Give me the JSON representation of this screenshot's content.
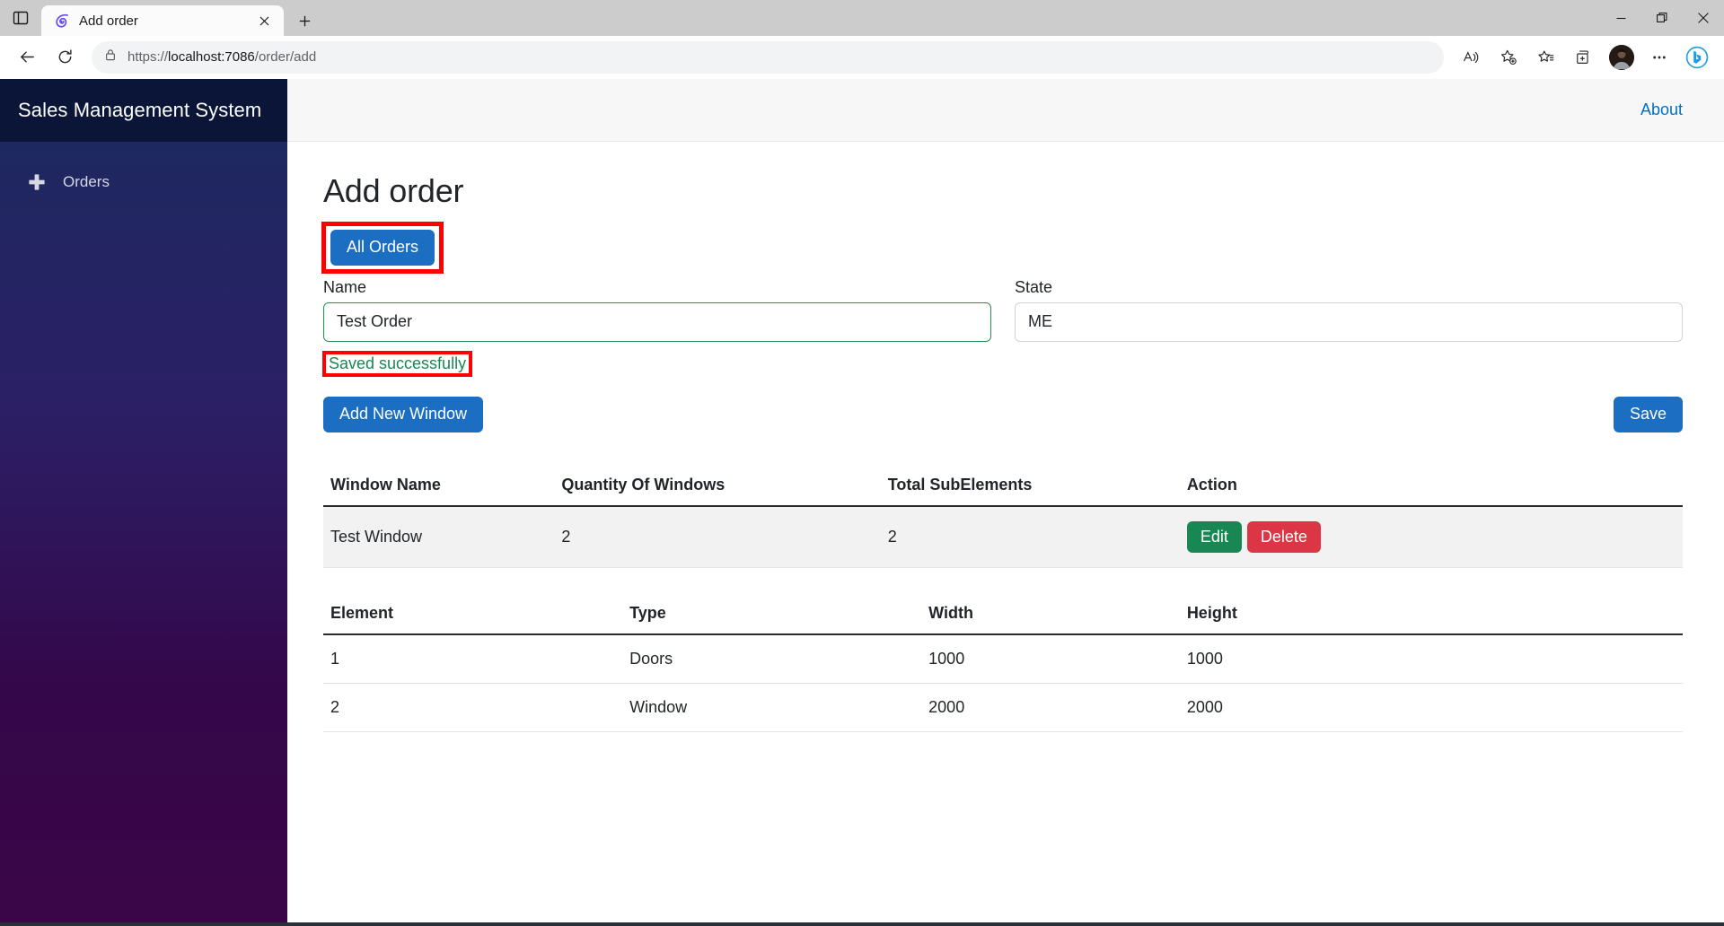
{
  "browser": {
    "tab": {
      "title": "Add order",
      "favicon_name": "blazor-favicon",
      "close_label": "×"
    },
    "new_tab_label": "+",
    "tab_list_icon": "tab-list-icon",
    "window_controls": {
      "minimize": "—",
      "restore": "restore",
      "close": "×"
    },
    "nav": {
      "back": "back-arrow",
      "refresh": "refresh-arrow"
    },
    "address": {
      "lock_icon": "lock-icon",
      "scheme": "https://",
      "host": "localhost:7086",
      "path": "/order/add",
      "full_url": "https://localhost:7086/order/add"
    },
    "toolbar_icons": [
      {
        "name": "read-aloud-icon",
        "label": "Read aloud"
      },
      {
        "name": "add-favorite-icon",
        "label": "Add this page to favorites"
      },
      {
        "name": "favorites-icon",
        "label": "Favorites"
      },
      {
        "name": "collections-icon",
        "label": "Collections"
      },
      {
        "name": "profile-avatar",
        "label": "Profile"
      },
      {
        "name": "settings-more-icon",
        "label": "Settings and more"
      },
      {
        "name": "copilot-bing-icon",
        "label": "Copilot"
      }
    ]
  },
  "app": {
    "brand": "Sales Management System",
    "sidebar": {
      "items": [
        {
          "label": "Orders",
          "icon": "plus-icon"
        }
      ]
    },
    "topbar": {
      "about_label": "About"
    },
    "page": {
      "title": "Add order",
      "all_orders_button": "All Orders",
      "name_label": "Name",
      "name_value": "Test Order",
      "state_label": "State",
      "state_value": "ME",
      "saved_message": "Saved successfully",
      "add_window_button": "Add New Window",
      "save_button": "Save"
    },
    "windows_table": {
      "headers": [
        "Window Name",
        "Quantity Of Windows",
        "Total SubElements",
        "Action"
      ],
      "rows": [
        {
          "window_name": "Test Window",
          "quantity": "2",
          "total_subelements": "2",
          "edit_label": "Edit",
          "delete_label": "Delete"
        }
      ]
    },
    "elements_table": {
      "headers": [
        "Element",
        "Type",
        "Width",
        "Height"
      ],
      "rows": [
        {
          "element": "1",
          "type": "Doors",
          "width": "1000",
          "height": "1000"
        },
        {
          "element": "2",
          "type": "Window",
          "width": "2000",
          "height": "2000"
        }
      ]
    }
  },
  "colors": {
    "primary": "#1b6ec2",
    "success": "#198754",
    "danger": "#dc3545",
    "link": "#0071c1",
    "annotation": "#ff0000",
    "sidebar_top": "#1b2a5e",
    "sidebar_bottom": "#3b0647",
    "brandbar": "#0b1538"
  }
}
